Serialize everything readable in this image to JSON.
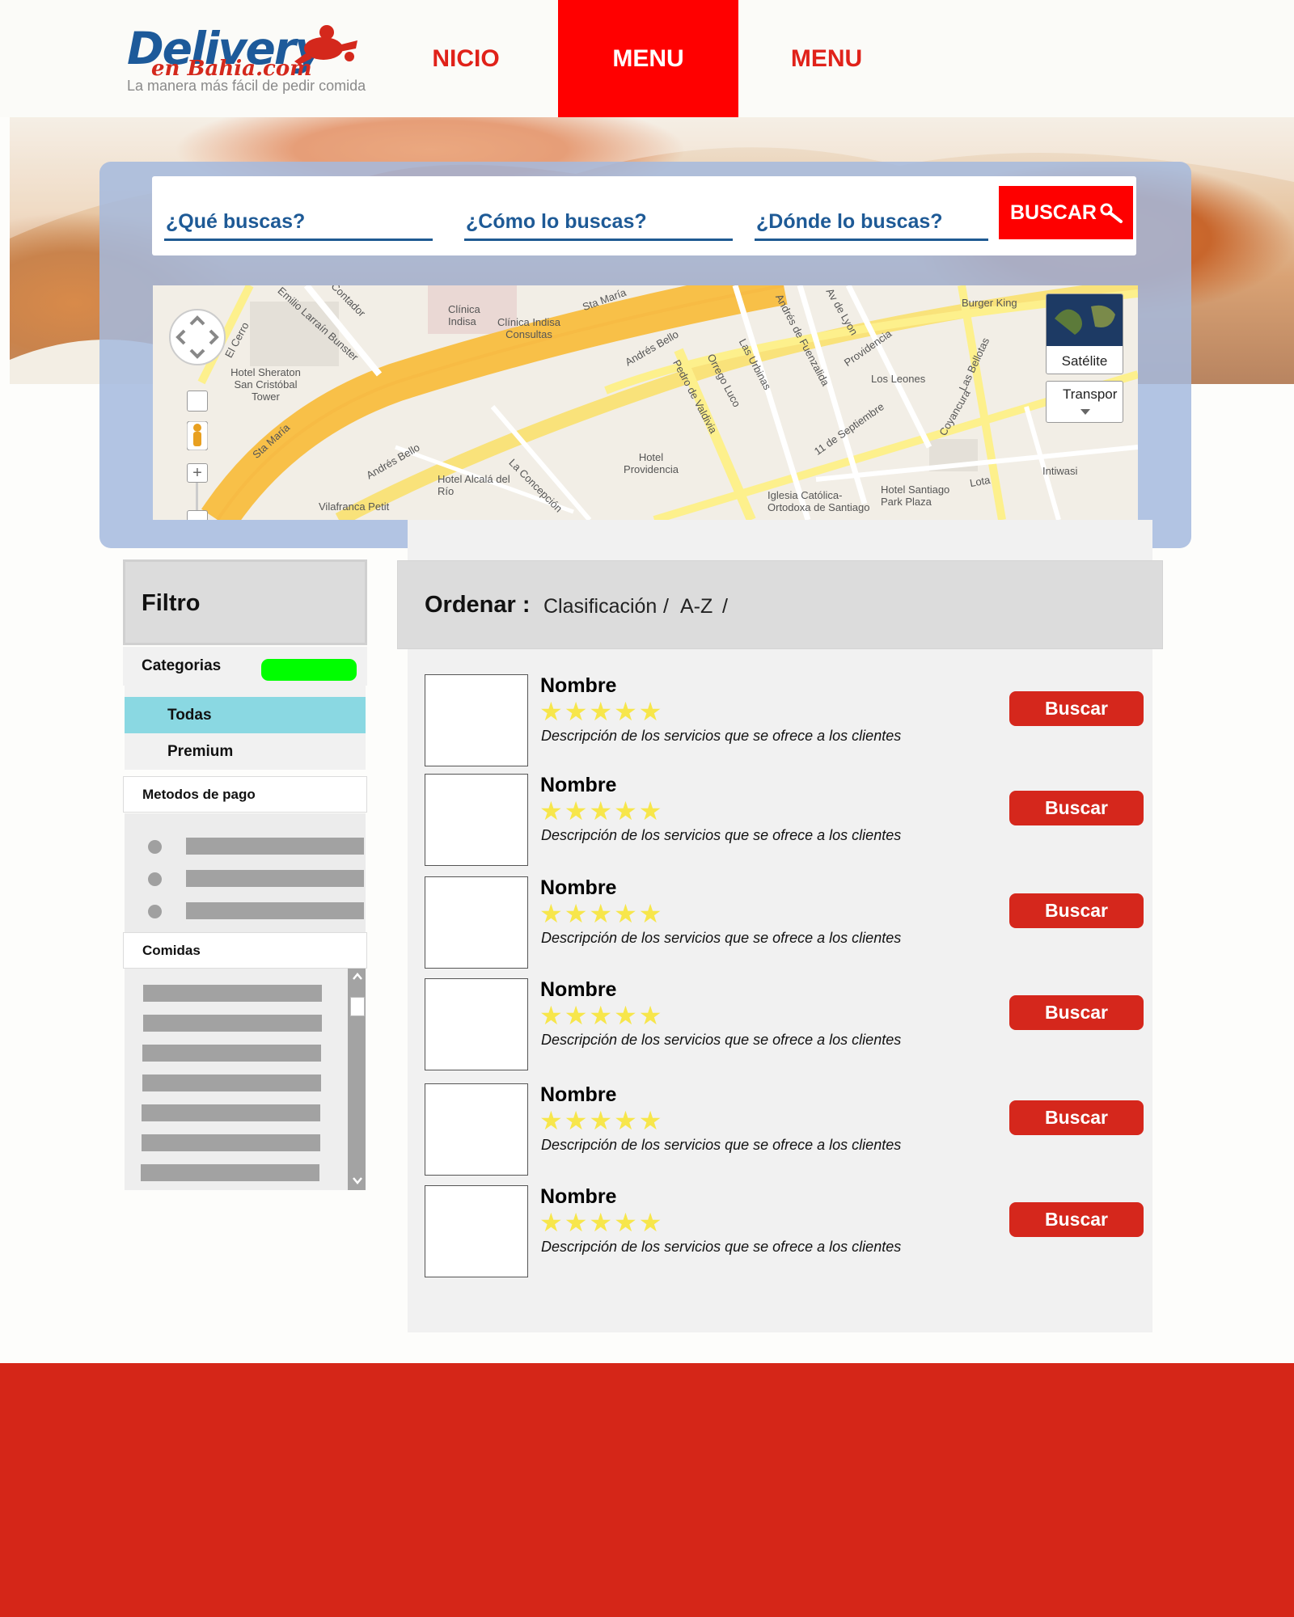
{
  "brand": {
    "logo_main": "Delivery",
    "logo_sub": "en Bahia.com",
    "tagline": "La manera más fácil de pedir comida"
  },
  "nav": {
    "items": [
      {
        "label": "NICIO",
        "active": false
      },
      {
        "label": "MENU",
        "active": true
      },
      {
        "label": "MENU",
        "active": false
      }
    ]
  },
  "search": {
    "what_placeholder": "¿Qué buscas?",
    "how_placeholder": "¿Cómo lo buscas?",
    "where_placeholder": "¿Dónde lo buscas?",
    "button_label": "BUSCAR"
  },
  "map": {
    "streets": [
      "El Cerro",
      "Emilio Larraín Bunster",
      "Contador",
      "Sta María",
      "Andrés Bello",
      "Pedro de Valdivia",
      "Orrego Luco",
      "Las Urbinas",
      "Andrés de Fuenzalida",
      "Providencia",
      "11 de Septiembre",
      "La Concepción",
      "Coyancura",
      "Las Bellotas",
      "Lota",
      "Av de Lyon"
    ],
    "places": [
      "Clínica Indisa",
      "Clínica Indisa Consultas",
      "Hotel Sheraton San Cristóbal Tower",
      "Hotel Alcalá del Río",
      "Hotel Providencia",
      "Iglesia Católica-Ortodoxa de Santiago",
      "Hotel Santiago Park Plaza",
      "Burger King",
      "Los Leones",
      "Intiwasi",
      "Vilafranca Petit"
    ],
    "satellite_label": "Satélite",
    "transport_label": "Transpor"
  },
  "sidebar": {
    "title": "Filtro",
    "categories_label": "Categorias",
    "categories": [
      {
        "label": "Todas",
        "selected": true
      },
      {
        "label": "Premium",
        "selected": false
      }
    ],
    "payment_label": "Metodos de pago",
    "food_label": "Comidas"
  },
  "sort": {
    "label": "Ordenar :",
    "options": [
      "Clasificación",
      "A-Z"
    ]
  },
  "results": [
    {
      "name": "Nombre",
      "rating": 5,
      "description": "Descripción de los servicios que se ofrece a los clientes",
      "button": "Buscar"
    },
    {
      "name": "Nombre",
      "rating": 5,
      "description": "Descripción de los servicios que se ofrece a los clientes",
      "button": "Buscar"
    },
    {
      "name": "Nombre",
      "rating": 5,
      "description": "Descripción de los servicios que se ofrece a los clientes",
      "button": "Buscar"
    },
    {
      "name": "Nombre",
      "rating": 5,
      "description": "Descripción de los servicios que se ofrece a los clientes",
      "button": "Buscar"
    },
    {
      "name": "Nombre",
      "rating": 5,
      "description": "Descripción de los servicios que se ofrece a los clientes",
      "button": "Buscar"
    },
    {
      "name": "Nombre",
      "rating": 5,
      "description": "Descripción de los servicios que se ofrece a los clientes",
      "button": "Buscar"
    }
  ],
  "colors": {
    "brand_red": "#d52618",
    "nav_active": "#ff0000",
    "search_blue": "#1e5a96",
    "toggle_green": "#00fe00",
    "selected_category": "#8ad8e2",
    "star_yellow": "#f7e64b"
  }
}
